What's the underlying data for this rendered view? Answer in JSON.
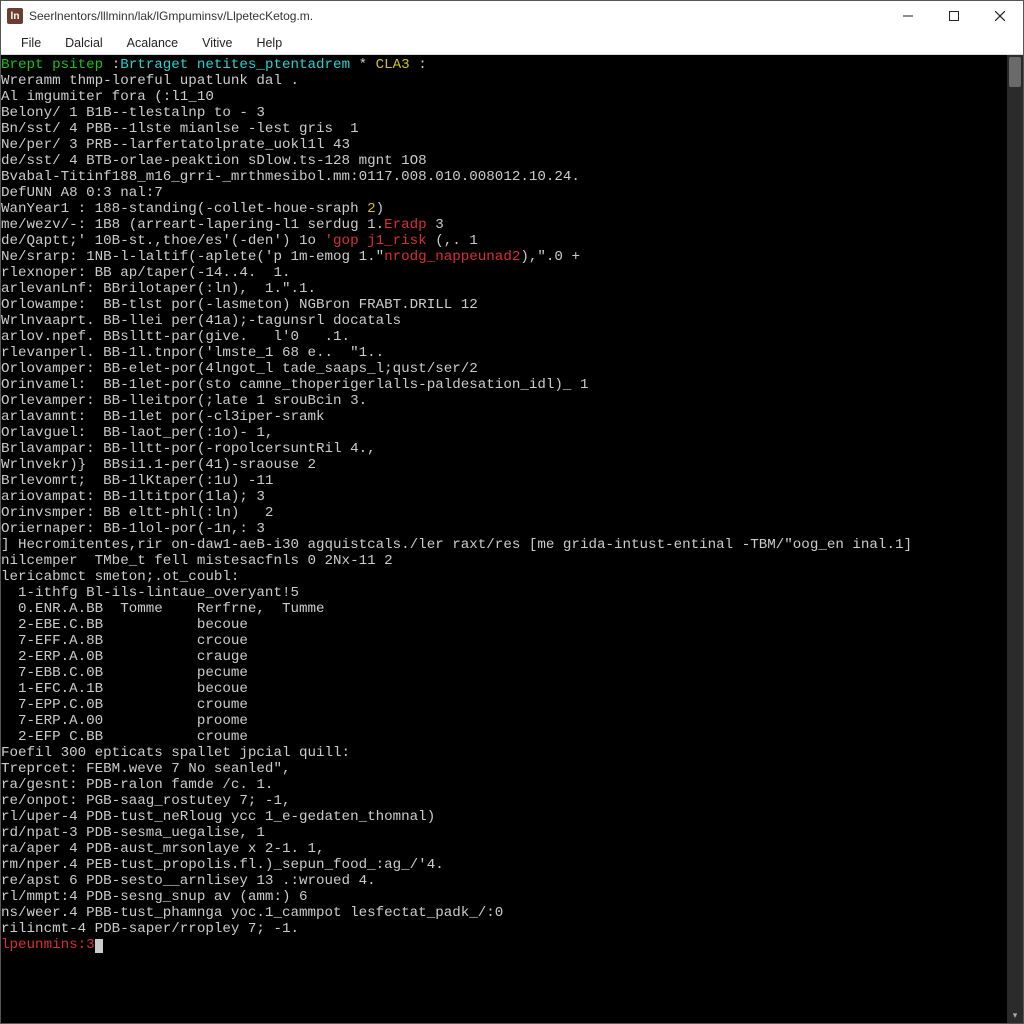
{
  "titlebar": {
    "icon_letter": "ln",
    "title": "Seerlnentors/lllminn/lak/lGmpuminsv/LlpetecKetog.m."
  },
  "menubar": {
    "items": [
      "File",
      "Dalcial",
      "Acalance",
      "Vitive",
      "Help"
    ]
  },
  "lines": [
    [
      [
        "g",
        "Brept psitep "
      ],
      [
        "w",
        ":"
      ],
      [
        "c",
        "Brtraget netites_ptentadrem"
      ],
      [
        "w",
        " * "
      ],
      [
        "y",
        "CLA3"
      ],
      [
        "w",
        " :"
      ]
    ],
    [
      [
        "w",
        ""
      ]
    ],
    [
      [
        "w",
        "Wreramm thmp-loreful upatlunk dal ."
      ]
    ],
    [
      [
        "w",
        ""
      ]
    ],
    [
      [
        "w",
        "Al imgumiter fora (:l1_10"
      ]
    ],
    [
      [
        "w",
        "Belony/ 1 B1B--tlestalnp to - 3"
      ]
    ],
    [
      [
        "w",
        "Bn/sst/ 4 PBB--1lste mianlse -lest gris  1"
      ]
    ],
    [
      [
        "w",
        "Ne/per/ 3 PRB--larfertatolprate_uokl1l 43"
      ]
    ],
    [
      [
        "w",
        "de/sst/ 4 BTB-orlae-peaktion sDlow.ts-128 mgnt 1O8"
      ]
    ],
    [
      [
        "w",
        "Bvabal-Titinf188_m16_grri-_mrthmesibol.mm:0117.008.010.008012.10.24."
      ]
    ],
    [
      [
        "w",
        ""
      ]
    ],
    [
      [
        "w",
        "DefUNN A8 0:3 nal:7"
      ]
    ],
    [
      [
        "w",
        "WanYear1 : 188-standing(-collet-houe-sraph "
      ],
      [
        "y",
        "2"
      ],
      [
        "w",
        ")"
      ]
    ],
    [
      [
        "w",
        "me/wezv/-: 1B8 (arreart-lapering-l1 serdug 1."
      ],
      [
        "r",
        "Eradp"
      ],
      [
        "w",
        " 3"
      ]
    ],
    [
      [
        "w",
        "de/Qaptt;' 10B-st.,thoe/es'(-den') 1o "
      ],
      [
        "r",
        "'gop j1_risk"
      ],
      [
        "w",
        " (,. 1"
      ]
    ],
    [
      [
        "w",
        "Ne/srarp: 1NB-l-laltif(-aplete('p 1m-emog 1.\""
      ],
      [
        "r",
        "nrodg_nappeunad2"
      ],
      [
        "w",
        "),\".0 +"
      ]
    ],
    [
      [
        "w",
        "rlexnoper: BB ap/taper(-14..4.  1."
      ]
    ],
    [
      [
        "w",
        "arlevanLnf: BBrilotaper(:ln),  1.\".1."
      ]
    ],
    [
      [
        "w",
        "Orlowampe:  BB-tlst por(-lasmeton) NGBron FRABT.DRILL 12"
      ]
    ],
    [
      [
        "w",
        "Wrlnvaaprt. BB-llei per(41a);-tagunsrl docatals"
      ]
    ],
    [
      [
        "w",
        "arlov.npef. BBslltt-par(give.   l'0   .1."
      ]
    ],
    [
      [
        "w",
        "rlevanperl. BB-1l.tnpor('lmste_1 68 e..  \"1.."
      ]
    ],
    [
      [
        "w",
        "Orlovamper: BB-elet-por(4lngot_l tade_saaps_l;qust/ser/2"
      ]
    ],
    [
      [
        "w",
        "Orinvamel:  BB-1let-por(sto camne_thoperigerlalls-paldesation_idl)_ 1"
      ]
    ],
    [
      [
        "w",
        "Orlevamper: BB-lleitpor(;late 1 srouBcin 3."
      ]
    ],
    [
      [
        "w",
        "arlavamnt:  BB-1let por(-cl3iper-sramk"
      ]
    ],
    [
      [
        "w",
        "Orlavguel:  BB-laot_per(:1o)- 1,"
      ]
    ],
    [
      [
        "w",
        "Brlavampar: BB-lltt-por(-ropolcersuntRil 4.,"
      ]
    ],
    [
      [
        "w",
        "Wrlnvekr)}  BBsi1.1-per(41)-sraouse 2"
      ]
    ],
    [
      [
        "w",
        "Brlevomrt;  BB-1lKtaper(:1u) -11"
      ]
    ],
    [
      [
        "w",
        "ariovampat: BB-1ltitpor(1la); 3"
      ]
    ],
    [
      [
        "w",
        "Orinvsmper: BB eltt-phl(:ln)   2"
      ]
    ],
    [
      [
        "w",
        "Oriernaper: BB-1lol-por(-1n,: 3"
      ]
    ],
    [
      [
        "w",
        "] Hecromitentes,rir on-daw1-aeB-i30 agquistcals./ler raxt/res [me grida-intust-entinal -TBM/\"oog_en inal.1]"
      ]
    ],
    [
      [
        "w",
        ""
      ]
    ],
    [
      [
        "w",
        "nilcemper  TMbe_t fell mistesacfnls 0 2Nx-11 2"
      ]
    ],
    [
      [
        "w",
        "lericabmct smeton;.ot_coubl:"
      ]
    ],
    [
      [
        "w",
        "  1-ithfg Bl-ils-lintaue_overyant!5"
      ]
    ],
    [
      [
        "w",
        "  0.ENR.A.BB  Tomme    Rerfrne,  Tumme"
      ]
    ],
    [
      [
        "w",
        "  2-EBE.C.BB           becoue"
      ]
    ],
    [
      [
        "w",
        "  7-EFF.A.8B           crcoue"
      ]
    ],
    [
      [
        "w",
        "  2-ERP.A.0B           crauge"
      ]
    ],
    [
      [
        "w",
        "  7-EBB.C.0B           pecume"
      ]
    ],
    [
      [
        "w",
        "  1-EFC.A.1B           becoue"
      ]
    ],
    [
      [
        "w",
        "  7-EPP.C.0B           croume"
      ]
    ],
    [
      [
        "w",
        "  7-ERP.A.00           proome"
      ]
    ],
    [
      [
        "w",
        "  2-EFP C.BB           croume"
      ]
    ],
    [
      [
        "w",
        "Foefil 300 epticats spallet jpcial quill:"
      ]
    ],
    [
      [
        "w",
        ""
      ]
    ],
    [
      [
        "w",
        "Treprcet: FEBM.weve 7 No seanled\","
      ]
    ],
    [
      [
        "w",
        "ra/gesnt: PDB-ralon famde /c. 1."
      ]
    ],
    [
      [
        "w",
        "re/onpot: PGB-saag_rostutey 7; -1,"
      ]
    ],
    [
      [
        "w",
        "rl/uper-4 PDB-tust_neRloug ycc 1_e-gedaten_thomnal)"
      ]
    ],
    [
      [
        "w",
        "rd/npat-3 PDB-sesma_uegalise, 1"
      ]
    ],
    [
      [
        "w",
        "ra/aper 4 PDB-aust_mrsonlaye x 2-1. 1,"
      ]
    ],
    [
      [
        "w",
        "rm/nper.4 PEB-tust_propolis.fl.)_sepun_food_:ag_/'4."
      ]
    ],
    [
      [
        "w",
        "re/apst 6 PDB-sesto__arnlisey 13 .:wroued 4."
      ]
    ],
    [
      [
        "w",
        "rl/mmpt:4 PDB-sesng_snup av (amm:) 6"
      ]
    ],
    [
      [
        "w",
        "ns/weer.4 PBB-tust_phamnga yoc.1_cammpot lesfectat_padk_/:0"
      ]
    ],
    [
      [
        "w",
        "rilincmt-4 PDB-saper/rropley 7; -1."
      ]
    ],
    [
      [
        "w",
        ""
      ]
    ]
  ],
  "prompt": {
    "label": "lpeunmins:3"
  }
}
